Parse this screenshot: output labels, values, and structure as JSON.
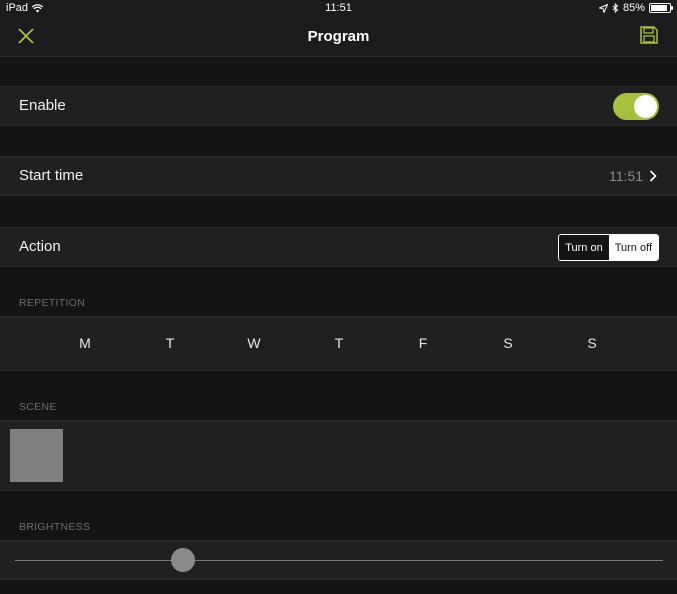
{
  "status_bar": {
    "device": "iPad",
    "time": "11:51",
    "battery": "85%",
    "battery_level": 0.85
  },
  "nav": {
    "title": "Program",
    "close_icon": "close-icon",
    "save_icon": "save-icon",
    "accent_color": "#a6c13d"
  },
  "enable": {
    "label": "Enable",
    "value": true
  },
  "start_time": {
    "label": "Start time",
    "value": "11:51"
  },
  "action": {
    "label": "Action",
    "options": [
      "Turn on",
      "Turn off"
    ],
    "selected": "Turn off"
  },
  "repetition": {
    "label": "REPETITION",
    "days": [
      "M",
      "T",
      "W",
      "T",
      "F",
      "S",
      "S"
    ]
  },
  "scene": {
    "label": "SCENE"
  },
  "brightness": {
    "label": "BRIGHTNESS",
    "value": 0.26
  }
}
